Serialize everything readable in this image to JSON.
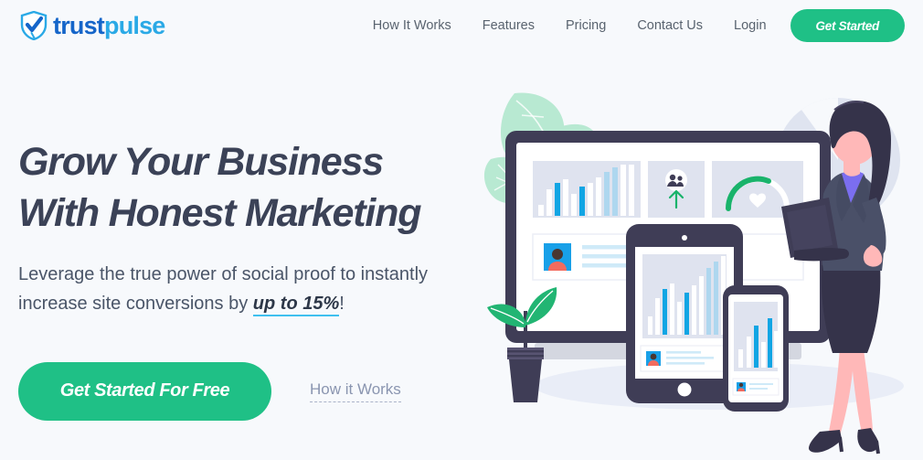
{
  "brand": {
    "name_part1": "trust",
    "name_part2": "pulse",
    "logo_icon": "shield-check-icon",
    "color_dark": "#1565c9",
    "color_light": "#2aa9e6"
  },
  "header": {
    "nav": [
      {
        "label": "How It Works"
      },
      {
        "label": "Features"
      },
      {
        "label": "Pricing"
      },
      {
        "label": "Contact Us"
      },
      {
        "label": "Login"
      }
    ],
    "cta_label": "Get Started",
    "cta_color": "#1fc086"
  },
  "hero": {
    "headline_line1": "Grow Your Business",
    "headline_line2": "With Honest Marketing",
    "sub_before": "Leverage the true power of social proof to instantly increase site conversions by ",
    "sub_highlight": "up to 15%",
    "sub_after": "!",
    "primary_cta": "Get Started For Free",
    "secondary_cta": "How it Works",
    "highlight_underline_color": "#3fc0ef",
    "headline_color": "#3b4257"
  },
  "illustration": {
    "name": "analytics-dashboard-devices-woman-illustration",
    "background_color": "#f7f9fc",
    "palette": {
      "device_frame": "#3f3d56",
      "screen_panel": "#dfe3ef",
      "bar_cyan": "#11a5e4",
      "bar_light_blue": "#aed7ef",
      "bar_white": "#ffffff",
      "leaf_mint": "#b7e8d0",
      "leaf_green": "#22b573",
      "gauge_green": "#19b36b",
      "pie_gray": "#dde2ef",
      "skin": "#ffb8b8",
      "suit": "#4a5068",
      "hair": "#35334a",
      "avatar_blue": "#18a0e8",
      "avatar_shirt": "#f26b5e"
    },
    "chart_data": {
      "type": "bar",
      "title": "",
      "categories": [
        "1",
        "2",
        "3",
        "4",
        "5",
        "6",
        "7",
        "8",
        "9",
        "10",
        "11"
      ],
      "series": [
        {
          "name": "monitor-bars",
          "values": [
            14,
            38,
            52,
            30,
            46,
            44,
            55,
            62,
            72,
            86,
            88
          ]
        },
        {
          "name": "tablet-bars",
          "values": [
            22,
            48,
            64,
            38,
            56,
            54,
            68,
            76,
            86,
            96,
            98
          ]
        },
        {
          "name": "phone-bars",
          "values": [
            30,
            58,
            78,
            46,
            84,
            66
          ]
        }
      ],
      "xlabel": "",
      "ylabel": "",
      "ylim": [
        0,
        100
      ],
      "grid": false,
      "legend": "none"
    }
  }
}
